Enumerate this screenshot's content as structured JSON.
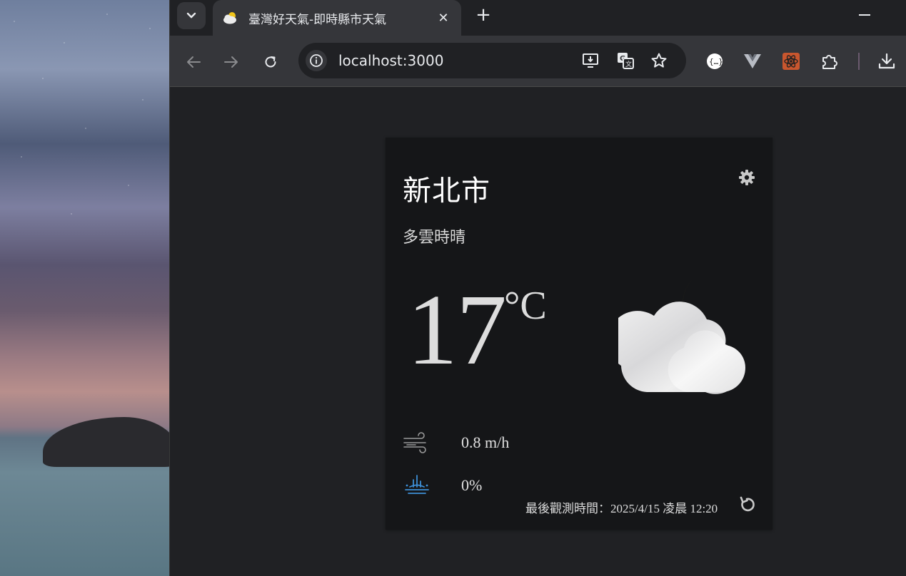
{
  "browser": {
    "tab_title": "臺灣好天氣-即時縣市天氣",
    "tab_close": "✕",
    "new_tab": "+",
    "url": "localhost:3000"
  },
  "icons": {
    "tab_menu": "chevron-down-icon",
    "favicon": "partly-cloudy-icon",
    "back": "arrow-left-icon",
    "forward": "arrow-right-icon",
    "reload": "reload-icon",
    "site_info": "info-icon",
    "install": "install-app-icon",
    "translate": "translate-icon",
    "bookmark": "star-icon",
    "ext_json": "json-formatter-icon",
    "ext_vue": "vue-devtools-icon",
    "ext_react": "react-devtools-icon",
    "extensions": "puzzle-icon",
    "downloads": "download-icon",
    "settings": "gear-icon",
    "wind": "wind-icon",
    "rain": "rain-icon",
    "refresh": "refresh-icon"
  },
  "weather": {
    "location": "新北市",
    "description": "多雲時晴",
    "temperature": "17",
    "unit": "°C",
    "wind_speed": "0.8 m/h",
    "rain_probability": "0%",
    "observation_time": "最後觀測時間：2025/4/15 凌晨 12:20"
  },
  "colors": {
    "card_bg": "#151618",
    "rain_icon": "#3d8fd6",
    "moon": "#f0c419"
  }
}
